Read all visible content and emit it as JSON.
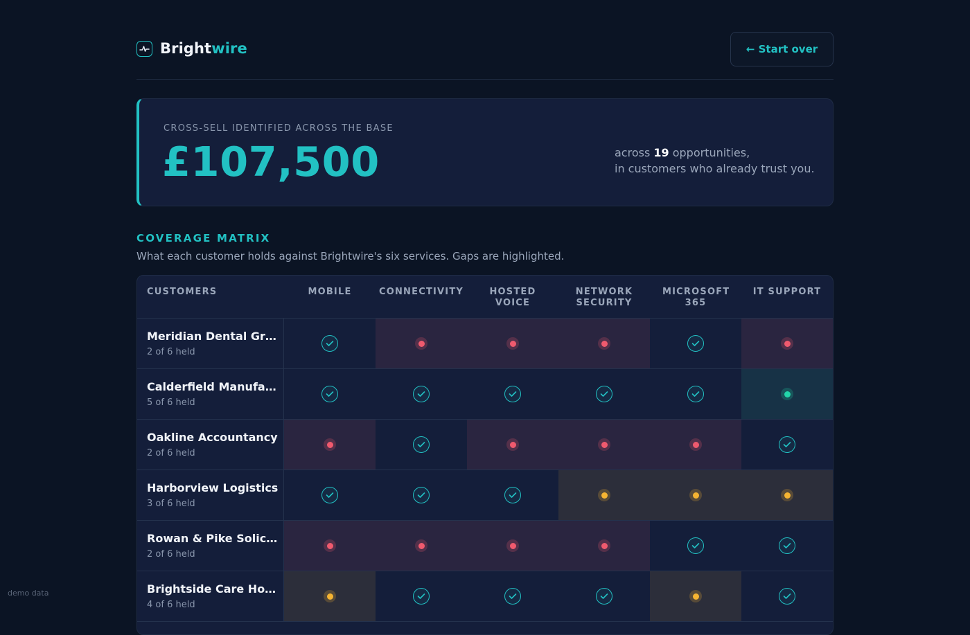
{
  "brand": {
    "part1": "Bright",
    "part2": "wire"
  },
  "header": {
    "start_over_label": "← Start over"
  },
  "hero": {
    "kicker": "CROSS-SELL IDENTIFIED ACROSS THE BASE",
    "amount": "£107,500",
    "line1_prefix": "across ",
    "opportunities": "19",
    "line1_suffix": " opportunities,",
    "line2": "in customers who already trust you."
  },
  "section": {
    "title": "COVERAGE MATRIX",
    "subtitle": "What each customer holds against Brightwire's six services. Gaps are highlighted."
  },
  "matrix": {
    "columns": [
      "CUSTOMERS",
      "MOBILE",
      "CONNECTIVITY",
      "HOSTED VOICE",
      "NETWORK SECURITY",
      "MICROSOFT 365",
      "IT SUPPORT"
    ],
    "rows": [
      {
        "name": "Meridian Dental Gr…",
        "held": "2 of 6 held",
        "cells": [
          "held",
          "gap",
          "gap",
          "gap",
          "held",
          "gap"
        ]
      },
      {
        "name": "Calderfield Manufa…",
        "held": "5 of 6 held",
        "cells": [
          "held",
          "held",
          "held",
          "held",
          "held",
          "ok"
        ]
      },
      {
        "name": "Oakline Accountancy",
        "held": "2 of 6 held",
        "cells": [
          "gap",
          "held",
          "gap",
          "gap",
          "gap",
          "held"
        ]
      },
      {
        "name": "Harborview Logistics",
        "held": "3 of 6 held",
        "cells": [
          "held",
          "held",
          "held",
          "warn",
          "warn",
          "warn"
        ]
      },
      {
        "name": "Rowan & Pike Solic…",
        "held": "2 of 6 held",
        "cells": [
          "gap",
          "gap",
          "gap",
          "gap",
          "held",
          "held"
        ]
      },
      {
        "name": "Brightside Care Ho…",
        "held": "4 of 6 held",
        "cells": [
          "warn",
          "held",
          "held",
          "held",
          "warn",
          "held"
        ]
      }
    ]
  },
  "footer": {
    "demo_label": "demo data"
  },
  "colors": {
    "accent": "#22c1c3",
    "gap": "#f05a6e",
    "warn": "#f5b432",
    "ok": "#22d6aa",
    "background": "#0b1424"
  }
}
